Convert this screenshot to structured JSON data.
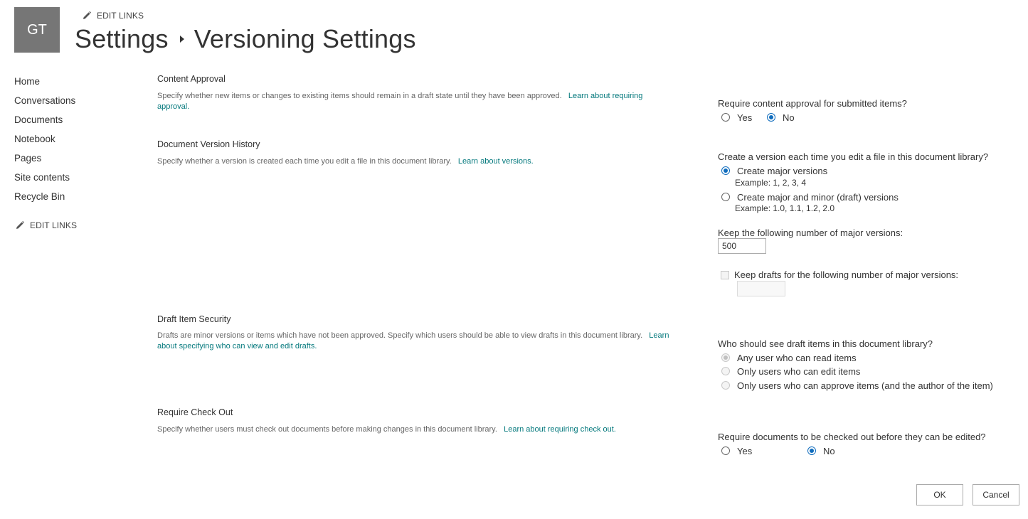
{
  "header": {
    "logo_initials": "GT",
    "edit_links": "EDIT LINKS",
    "breadcrumb_parent": "Settings",
    "breadcrumb_current": "Versioning Settings"
  },
  "nav": {
    "items": [
      "Home",
      "Conversations",
      "Documents",
      "Notebook",
      "Pages",
      "Site contents",
      "Recycle Bin"
    ],
    "edit_links": "EDIT LINKS"
  },
  "content_approval": {
    "title": "Content Approval",
    "description": "Specify whether new items or changes to existing items should remain in a draft state until they have been approved.",
    "link": "Learn about requiring approval.",
    "question": "Require content approval for submitted items?",
    "options": [
      "Yes",
      "No"
    ],
    "selected": "No"
  },
  "version_history": {
    "title": "Document Version History",
    "description": "Specify whether a version is created each time you edit a file in this document library.",
    "link": "Learn about versions.",
    "question": "Create a version each time you edit a file in this document library?",
    "option_major": "Create major versions",
    "example_major": "Example: 1, 2, 3, 4",
    "option_minor": "Create major and minor (draft) versions",
    "example_minor": "Example: 1.0, 1.1, 1.2, 2.0",
    "selected": "Create major versions",
    "keep_major_label": "Keep the following number of major versions:",
    "keep_major_value": "500",
    "keep_drafts_label": "Keep drafts for the following number of major versions:",
    "keep_drafts_value": ""
  },
  "draft_security": {
    "title": "Draft Item Security",
    "description": "Drafts are minor versions or items which have not been approved. Specify which users should be able to view drafts in this document library.",
    "link": "Learn about specifying who can view and edit drafts.",
    "question": "Who should see draft items in this document library?",
    "options": [
      "Any user who can read items",
      "Only users who can edit items",
      "Only users who can approve items (and the author of the item)"
    ],
    "selected": "Any user who can read items"
  },
  "check_out": {
    "title": "Require Check Out",
    "description": "Specify whether users must check out documents before making changes in this document library.",
    "link": "Learn about requiring check out.",
    "question": "Require documents to be checked out before they can be edited?",
    "options": [
      "Yes",
      "No"
    ],
    "selected": "No"
  },
  "buttons": {
    "ok": "OK",
    "cancel": "Cancel"
  },
  "colors": {
    "accent": "#0f6cbd",
    "link": "#03787c",
    "logo_bg": "#767676"
  }
}
